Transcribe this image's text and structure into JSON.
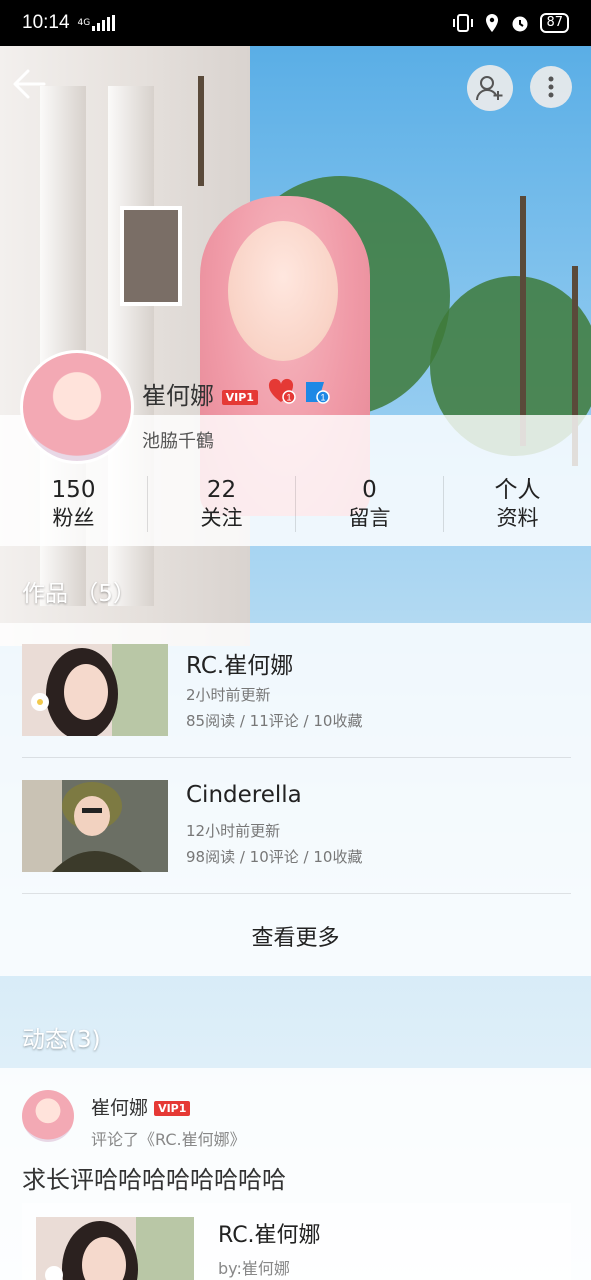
{
  "status_bar": {
    "time": "10:14",
    "network": "4G",
    "battery": "87"
  },
  "header": {
    "back_icon": "arrow-left-icon",
    "follow_icon": "add-user-icon",
    "more_icon": "more-vertical-icon"
  },
  "profile": {
    "name": "崔何娜",
    "vip_label": "VIP1",
    "heart_badge_count": "1",
    "medal_badge_count": "1",
    "signature": "池脇千鶴"
  },
  "stats": [
    {
      "value": "150",
      "label": "粉丝"
    },
    {
      "value": "22",
      "label": "关注"
    },
    {
      "value": "0",
      "label": "留言"
    },
    {
      "value": "个人",
      "label": "资料"
    }
  ],
  "works": {
    "title": "作品 （5）",
    "items": [
      {
        "title": "RC.崔何娜",
        "updated": "2小时前更新",
        "stats": "85阅读 / 11评论 / 10收藏"
      },
      {
        "title": "Cinderella",
        "updated": "12小时前更新",
        "stats": "98阅读 / 10评论 / 10收藏"
      }
    ],
    "more_label": "查看更多"
  },
  "activity": {
    "title": "动态(3)",
    "item": {
      "user": "崔何娜",
      "vip_label": "VIP1",
      "action": "评论了《RC.崔何娜》",
      "text": "求长评哈哈哈哈哈哈哈哈",
      "card_title": "RC.崔何娜",
      "card_by": "by:崔何娜"
    }
  }
}
